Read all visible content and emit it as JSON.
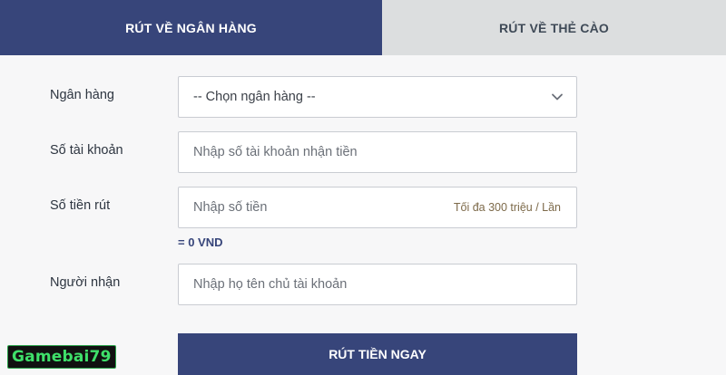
{
  "tabs": [
    {
      "label": "RÚT VỀ NGÂN HÀNG",
      "active": true
    },
    {
      "label": "RÚT VỀ THẺ CÀO",
      "active": false
    }
  ],
  "form": {
    "bank": {
      "label": "Ngân hàng",
      "selected": "-- Chọn ngân hàng --",
      "icon": "chevron-down-icon"
    },
    "account": {
      "label": "Số tài khoản",
      "placeholder": "Nhập số tài khoản nhận tiền",
      "value": ""
    },
    "amount": {
      "label": "Số tiền rút",
      "placeholder": "Nhập số tiền",
      "value": "",
      "hint": "Tối đa 300 triệu / Lần",
      "converted": "= 0 VND"
    },
    "recipient": {
      "label": "Người nhận",
      "placeholder": "Nhập họ tên chủ tài khoản",
      "value": ""
    },
    "submit_label": "RÚT TIỀN NGAY"
  },
  "watermark": {
    "text": "Gamebai79"
  },
  "colors": {
    "primary": "#37457a",
    "inactive_tab": "#dcdedf",
    "background": "#f7f7f8",
    "hint": "#7d6a4a",
    "logo_green": "#3fe06a"
  }
}
